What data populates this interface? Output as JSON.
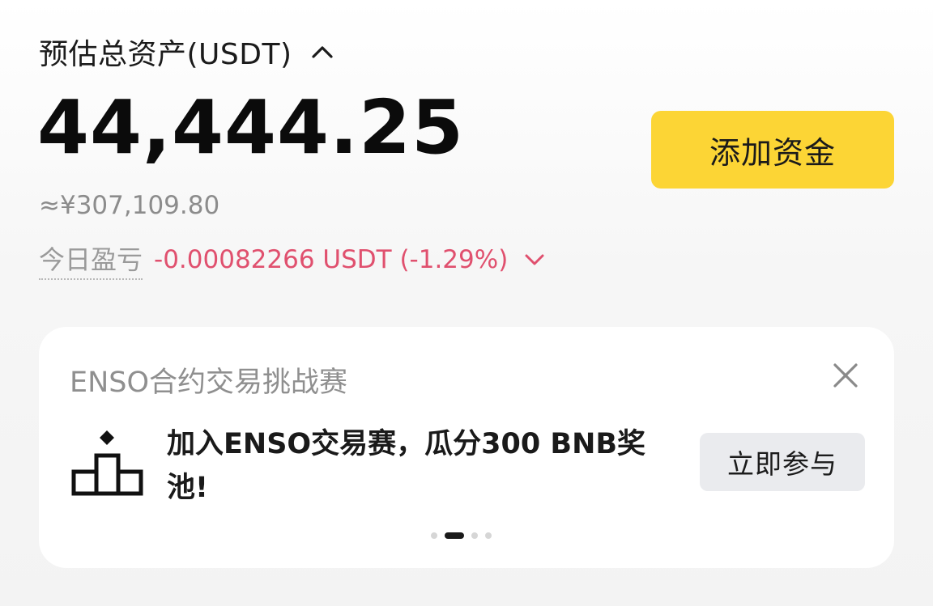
{
  "asset": {
    "title": "预估总资产(USDT)",
    "balance": "44,444.25",
    "fiat_equivalent": "≈¥307,109.80",
    "pnl_label": "今日盈亏",
    "pnl_value": "-0.00082266 USDT (-1.29%)",
    "pnl_color": "#e0506e"
  },
  "actions": {
    "add_funds_label": "添加资金",
    "add_funds_color": "#fcd535"
  },
  "promo": {
    "title": "ENSO合约交易挑战赛",
    "message": "加入ENSO交易赛，瓜分300 BNB奖池!",
    "join_label": "立即参与",
    "carousel_active_index": 1,
    "carousel_count": 4
  },
  "icons": {
    "collapse": "chevron-up-icon",
    "expand": "chevron-down-icon",
    "close": "close-icon",
    "podium": "podium-icon"
  }
}
